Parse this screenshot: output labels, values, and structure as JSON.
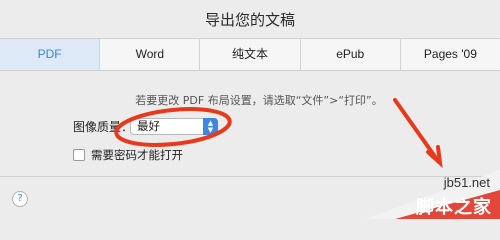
{
  "dialog": {
    "title": "导出您的文稿"
  },
  "tabs": [
    {
      "label": "PDF",
      "active": true
    },
    {
      "label": "Word",
      "active": false
    },
    {
      "label": "纯文本",
      "active": false
    },
    {
      "label": "ePub",
      "active": false
    },
    {
      "label": "Pages '09",
      "active": false
    }
  ],
  "content": {
    "hint": "若要更改 PDF 布局设置，请选取“文件”>“打印”。",
    "image_quality_label": "图像质量：",
    "image_quality_value": "最好",
    "password_checkbox_label": "需要密码才能打开",
    "password_checked": false
  },
  "footer": {
    "help_label": "?"
  },
  "watermark": {
    "url": "jb51.net",
    "name": "脚本之家"
  },
  "colors": {
    "accent": "#3f82d4",
    "annotation": "#e8391c"
  }
}
